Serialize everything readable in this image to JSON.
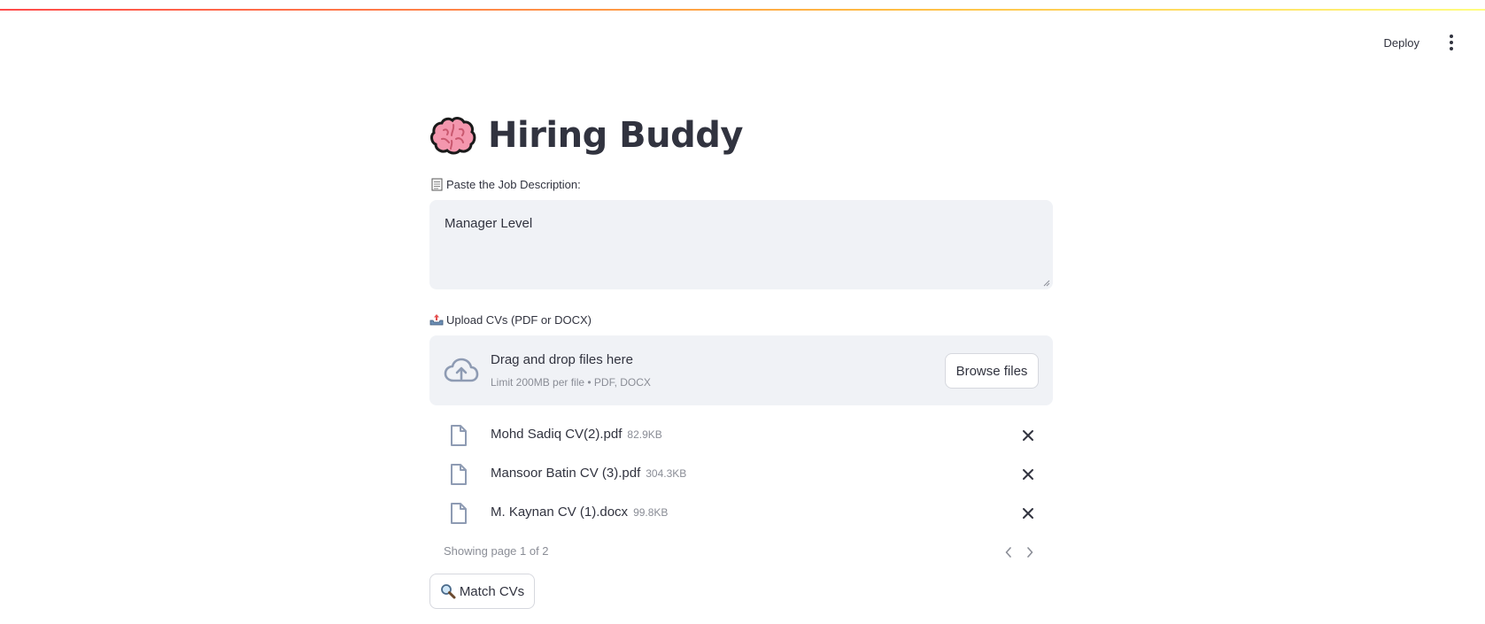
{
  "header": {
    "deploy_label": "Deploy",
    "menu_icon": "kebab-menu-icon"
  },
  "app": {
    "title": "Hiring Buddy",
    "title_icon": "brain-icon"
  },
  "job_description": {
    "label": "Paste the Job Description:",
    "label_icon": "page-facing-up-icon",
    "value": "Manager Level"
  },
  "upload": {
    "label": "Upload CVs (PDF or DOCX)",
    "label_icon": "outbox-tray-icon",
    "dropzone_title": "Drag and drop files here",
    "dropzone_subtitle": "Limit 200MB per file • PDF, DOCX",
    "browse_label": "Browse files",
    "files": [
      {
        "name": "Mohd Sadiq CV(2).pdf",
        "size": "82.9KB"
      },
      {
        "name": "Mansoor Batin CV (3).pdf",
        "size": "304.3KB"
      },
      {
        "name": "M. Kaynan CV (1).docx",
        "size": "99.8KB"
      }
    ],
    "pager_text": "Showing page 1 of 2"
  },
  "actions": {
    "match_label": "Match CVs",
    "match_icon": "magnifying-glass-icon"
  },
  "colors": {
    "text": "#31333f",
    "muted": "#8a8d96",
    "input_bg": "#f0f2f6",
    "accent": "#ff4b4b"
  }
}
